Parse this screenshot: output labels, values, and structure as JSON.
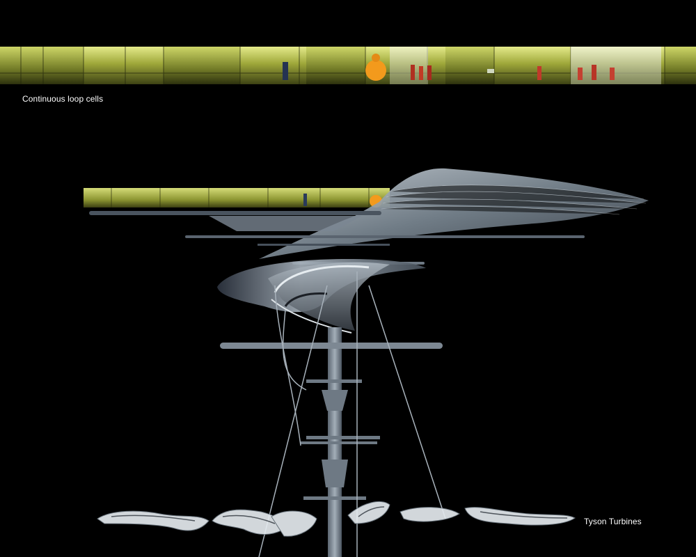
{
  "captions": {
    "top": "Continuous loop cells",
    "bottom": "Tyson Turbines"
  },
  "colors": {
    "background": "#000000",
    "foliage": "#b8c24a",
    "structure": "#8a96a2",
    "orange_figure": "#f39a1c"
  }
}
